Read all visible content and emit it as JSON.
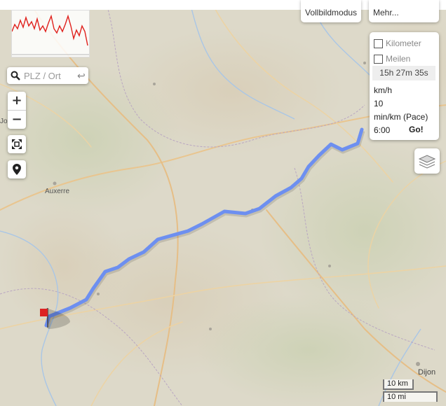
{
  "map": {
    "route_color": "#6d8ff0",
    "place_labels": {
      "auxerre": "Auxerre",
      "dijon": "Dijon",
      "left_edge": "Joi"
    }
  },
  "elevation_profile": {
    "line_color": "#e0201c"
  },
  "controls": {
    "search_placeholder": "PLZ / Ort",
    "zoom_in": "+",
    "zoom_out": "−",
    "fullscreen_button": "Vollbildmodus",
    "more_button": "Mehr..."
  },
  "panel": {
    "kilometer_label": "Kilometer",
    "meilen_label": "Meilen",
    "duration": "15h 27m 35s",
    "speed_unit": "km/h",
    "speed_value": "10",
    "pace_unit": "min/km (Pace)",
    "pace_value": "6:00",
    "go_button": "Go!"
  },
  "scale": {
    "metric": "10 km",
    "imperial": "10 mi"
  }
}
